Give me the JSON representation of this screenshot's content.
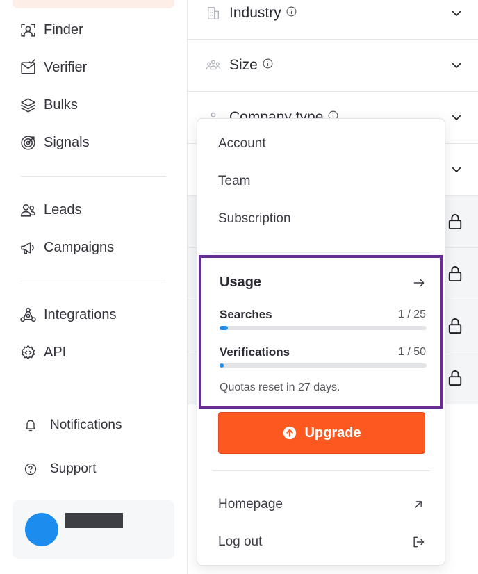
{
  "sidebar": {
    "primary_items": [
      {
        "label": "Finder",
        "icon": "finder-icon"
      },
      {
        "label": "Verifier",
        "icon": "verifier-icon"
      },
      {
        "label": "Bulks",
        "icon": "bulks-icon"
      },
      {
        "label": "Signals",
        "icon": "signals-icon"
      }
    ],
    "secondary_items": [
      {
        "label": "Leads",
        "icon": "leads-icon"
      },
      {
        "label": "Campaigns",
        "icon": "megaphone-icon"
      }
    ],
    "tertiary_items": [
      {
        "label": "Integrations",
        "icon": "integrations-icon"
      },
      {
        "label": "API",
        "icon": "gear-icon"
      }
    ],
    "bottom_items": [
      {
        "label": "Notifications",
        "icon": "bell-icon"
      },
      {
        "label": "Support",
        "icon": "help-icon"
      }
    ]
  },
  "filters": [
    {
      "label": "Industry",
      "icon": "building-icon"
    },
    {
      "label": "Size",
      "icon": "people-icon"
    },
    {
      "label": "Company type",
      "icon": "company-type-icon"
    }
  ],
  "menu": {
    "items": [
      "Account",
      "Team",
      "Subscription"
    ],
    "usage": {
      "title": "Usage",
      "quotas": [
        {
          "label": "Searches",
          "count": "1 / 25",
          "used": 1,
          "total": 25
        },
        {
          "label": "Verifications",
          "count": "1 / 50",
          "used": 1,
          "total": 50
        }
      ],
      "reset_text": "Quotas reset in 27 days."
    },
    "upgrade_label": "Upgrade",
    "footer_items": [
      {
        "label": "Homepage",
        "icon": "external-arrow-icon"
      },
      {
        "label": "Log out",
        "icon": "logout-icon"
      }
    ]
  },
  "colors": {
    "accent": "#fc5820",
    "progress": "#1c8cef",
    "highlight_border": "#6a2c91",
    "avatar": "#1c8cef"
  }
}
